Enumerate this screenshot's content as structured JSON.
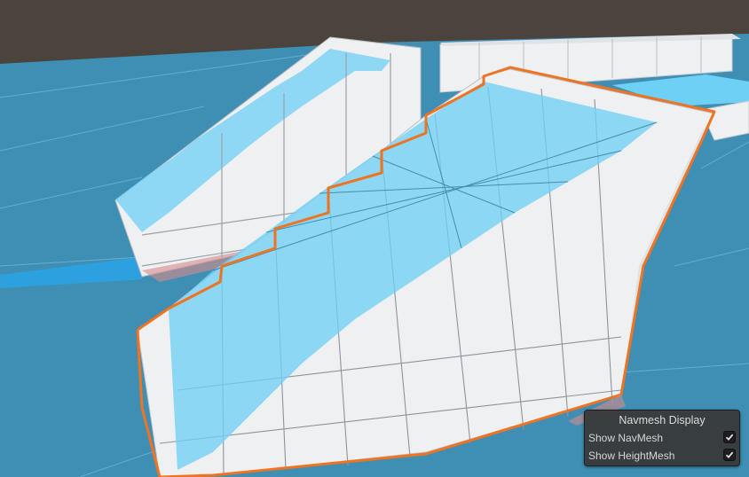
{
  "scene": {
    "colors": {
      "ground": "#3f8fb5",
      "navmesh": "#6fd0f5",
      "wall": "#eef0f2",
      "selection_outline": "#ef7320",
      "sky_band": "#4b443d"
    }
  },
  "navmesh_display": {
    "title": "Navmesh Display",
    "show_navmesh": {
      "label": "Show NavMesh",
      "checked": true
    },
    "show_heightmesh": {
      "label": "Show HeightMesh",
      "checked": true
    },
    "check_icon": "checkmark-icon"
  }
}
